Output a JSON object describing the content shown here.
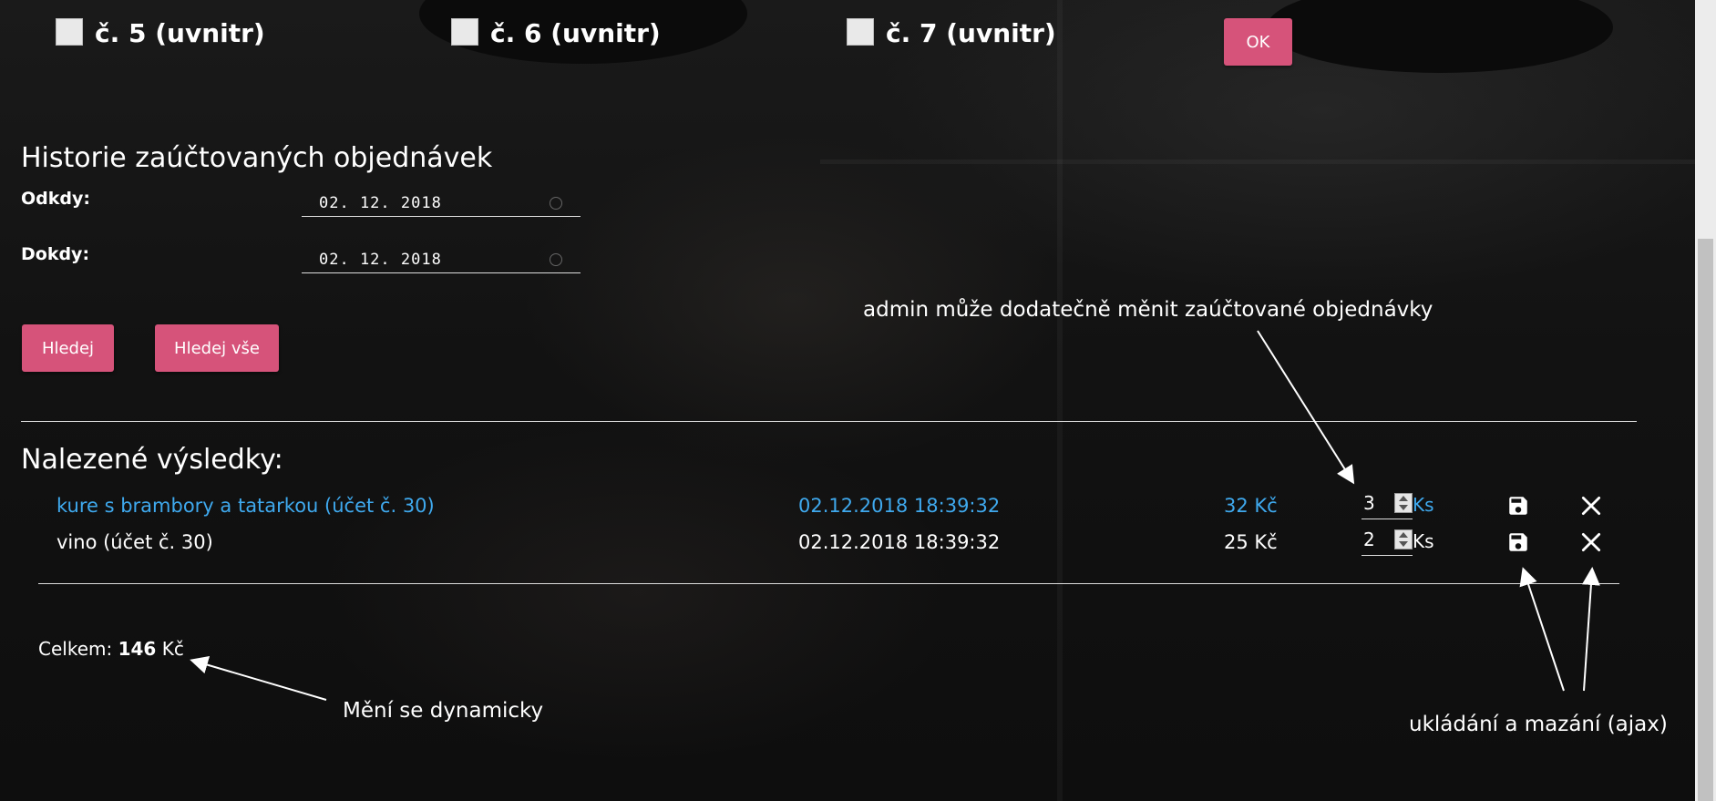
{
  "tables": {
    "items": [
      {
        "label": "č. 5 (uvnitr)"
      },
      {
        "label": "č. 6 (uvnitr)"
      },
      {
        "label": "č. 7 (uvnitr)"
      }
    ],
    "ok_label": "OK"
  },
  "history": {
    "title": "Historie zaúčtovaných objednávek",
    "from_label": "Odkdy:",
    "from_value": "02. 12. 2018",
    "to_label": "Dokdy:",
    "to_value": "02. 12. 2018",
    "search_label": "Hledej",
    "search_all_label": "Hledej vše"
  },
  "results": {
    "title": "Nalezené výsledky:",
    "rows": [
      {
        "name": "kure s brambory a tatarkou (účet č. 30)",
        "datetime": "02.12.2018 18:39:32",
        "price": "32 Kč",
        "qty": "3",
        "unit": "Ks"
      },
      {
        "name": "vino (účet č. 30)",
        "datetime": "02.12.2018 18:39:32",
        "price": "25 Kč",
        "qty": "2",
        "unit": "Ks"
      }
    ],
    "total_label": "Celkem:",
    "total_value": "146",
    "total_currency": "Kč"
  },
  "annotations": {
    "admin_note": "admin může dodatečně měnit zaúčtované objednávky",
    "dynamic_note": "Mění se dynamicky",
    "ajax_note": "ukládání a mazání (ajax)"
  },
  "colors": {
    "accent_button": "#d6537a",
    "highlight_text": "#3fa9ee"
  },
  "icons": {
    "save": "floppy-disk-icon",
    "delete": "close-icon"
  }
}
